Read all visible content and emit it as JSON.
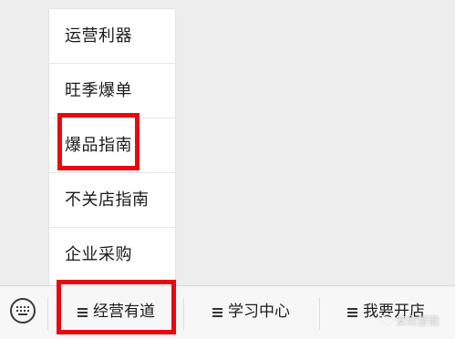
{
  "submenu": {
    "items": [
      {
        "label": "运营利器"
      },
      {
        "label": "旺季爆单"
      },
      {
        "label": "爆品指南"
      },
      {
        "label": "不关店指南"
      },
      {
        "label": "企业采购"
      }
    ]
  },
  "menubar": {
    "keyboard_icon": "keyboard-icon",
    "buttons": [
      {
        "label": "经营有道",
        "icon": "menu-lines-icon"
      },
      {
        "label": "学习中心",
        "icon": "menu-lines-icon"
      },
      {
        "label": "我要开店",
        "icon": "menu-lines-icon"
      }
    ]
  },
  "highlights": {
    "color": "#e8080f"
  },
  "watermark": {
    "text": "安欣智能",
    "icon": "wechat-official-account-icon"
  },
  "colors": {
    "background": "#ededed",
    "menubar": "#f7f7f7",
    "popup": "#ffffff",
    "text": "#1b1b1b"
  }
}
